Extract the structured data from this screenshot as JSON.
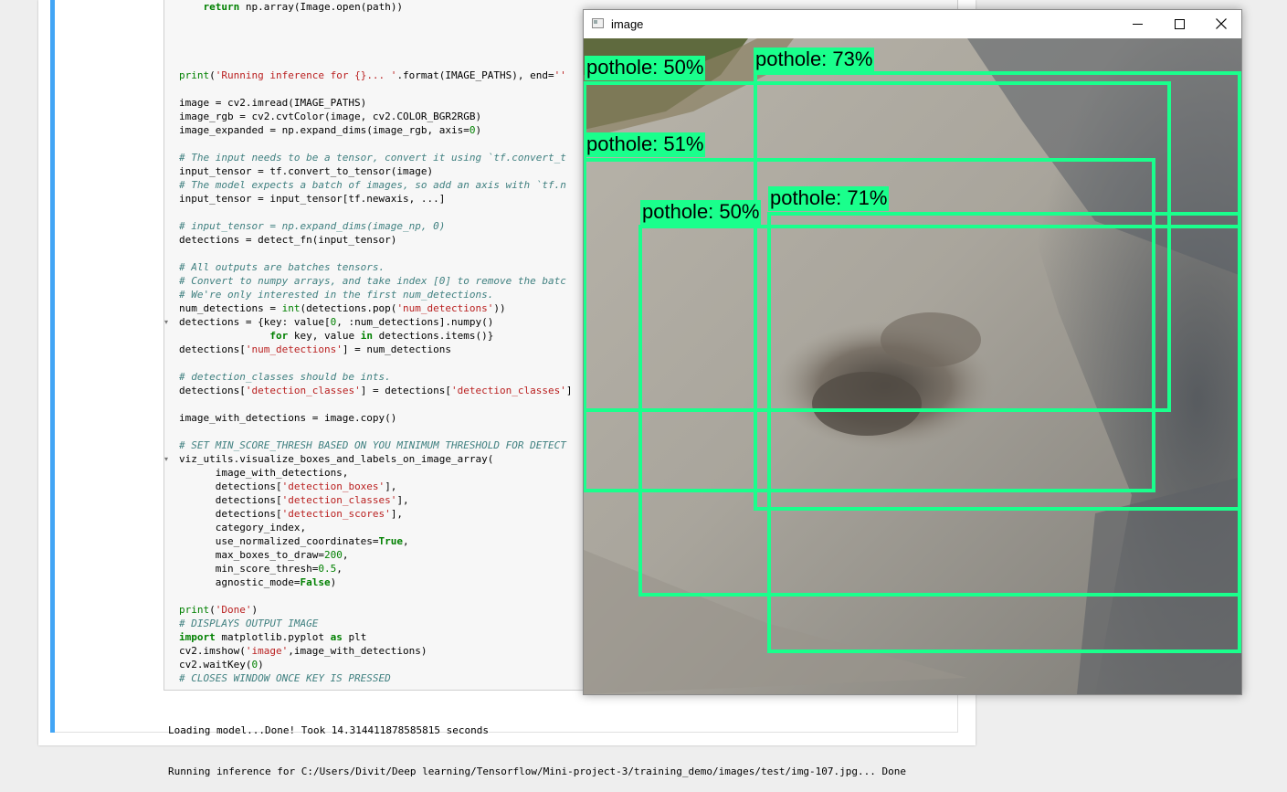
{
  "code_lines": [
    {
      "fold": false,
      "html": "    <span class=\"k\">return</span> np.array(Image.open(path))"
    },
    {
      "fold": false,
      "html": ""
    },
    {
      "fold": false,
      "html": ""
    },
    {
      "fold": false,
      "html": ""
    },
    {
      "fold": false,
      "html": ""
    },
    {
      "fold": false,
      "html": "<span class=\"n\">print</span>(<span class=\"s\">'Running inference for {}... '</span>.format(IMAGE_PATHS), end=<span class=\"s\">''</span>"
    },
    {
      "fold": false,
      "html": ""
    },
    {
      "fold": false,
      "html": "image = cv2.imread(IMAGE_PATHS)"
    },
    {
      "fold": false,
      "html": "image_rgb = cv2.cvtColor(image, cv2.COLOR_BGR2RGB)"
    },
    {
      "fold": false,
      "html": "image_expanded = np.expand_dims(image_rgb, axis=<span class=\"num\">0</span>)"
    },
    {
      "fold": false,
      "html": ""
    },
    {
      "fold": false,
      "html": "<span class=\"c\"># The input needs to be a tensor, convert it using `tf.convert_t</span>"
    },
    {
      "fold": false,
      "html": "input_tensor = tf.convert_to_tensor(image)"
    },
    {
      "fold": false,
      "html": "<span class=\"c\"># The model expects a batch of images, so add an axis with `tf.n</span>"
    },
    {
      "fold": false,
      "html": "input_tensor = input_tensor[tf.newaxis, ...]"
    },
    {
      "fold": false,
      "html": ""
    },
    {
      "fold": false,
      "html": "<span class=\"c\"># input_tensor = np.expand_dims(image_np, 0)</span>"
    },
    {
      "fold": false,
      "html": "detections = detect_fn(input_tensor)"
    },
    {
      "fold": false,
      "html": ""
    },
    {
      "fold": false,
      "html": "<span class=\"c\"># All outputs are batches tensors.</span>"
    },
    {
      "fold": false,
      "html": "<span class=\"c\"># Convert to numpy arrays, and take index [0] to remove the batc</span>"
    },
    {
      "fold": false,
      "html": "<span class=\"c\"># We're only interested in the first num_detections.</span>"
    },
    {
      "fold": false,
      "html": "num_detections = <span class=\"n\">int</span>(detections.pop(<span class=\"s\">'num_detections'</span>))"
    },
    {
      "fold": true,
      "html": "detections = {key: value[<span class=\"num\">0</span>, :num_detections].numpy()"
    },
    {
      "fold": false,
      "html": "               <span class=\"k\">for</span> key, value <span class=\"k\">in</span> detections.items()}"
    },
    {
      "fold": false,
      "html": "detections[<span class=\"s\">'num_detections'</span>] = num_detections"
    },
    {
      "fold": false,
      "html": ""
    },
    {
      "fold": false,
      "html": "<span class=\"c\"># detection_classes should be ints.</span>"
    },
    {
      "fold": false,
      "html": "detections[<span class=\"s\">'detection_classes'</span>] = detections[<span class=\"s\">'detection_classes'</span>]"
    },
    {
      "fold": false,
      "html": ""
    },
    {
      "fold": false,
      "html": "image_with_detections = image.copy()"
    },
    {
      "fold": false,
      "html": ""
    },
    {
      "fold": false,
      "html": "<span class=\"c\"># SET MIN_SCORE_THRESH BASED ON YOU MINIMUM THRESHOLD FOR DETECT</span>"
    },
    {
      "fold": true,
      "html": "viz_utils.visualize_boxes_and_labels_on_image_array("
    },
    {
      "fold": false,
      "html": "      image_with_detections,"
    },
    {
      "fold": false,
      "html": "      detections[<span class=\"s\">'detection_boxes'</span>],"
    },
    {
      "fold": false,
      "html": "      detections[<span class=\"s\">'detection_classes'</span>],"
    },
    {
      "fold": false,
      "html": "      detections[<span class=\"s\">'detection_scores'</span>],"
    },
    {
      "fold": false,
      "html": "      category_index,"
    },
    {
      "fold": false,
      "html": "      use_normalized_coordinates=<span class=\"k\">True</span>,"
    },
    {
      "fold": false,
      "html": "      max_boxes_to_draw=<span class=\"num\">200</span>,"
    },
    {
      "fold": false,
      "html": "      min_score_thresh=<span class=\"num\">0.5</span>,"
    },
    {
      "fold": false,
      "html": "      agnostic_mode=<span class=\"k\">False</span>)"
    },
    {
      "fold": false,
      "html": ""
    },
    {
      "fold": false,
      "html": "<span class=\"n\">print</span>(<span class=\"s\">'Done'</span>)"
    },
    {
      "fold": false,
      "html": "<span class=\"c\"># DISPLAYS OUTPUT IMAGE</span>"
    },
    {
      "fold": false,
      "html": "<span class=\"k\">import</span> matplotlib.pyplot <span class=\"k\">as</span> plt"
    },
    {
      "fold": false,
      "html": "cv2.imshow(<span class=\"s\">'image'</span>,image_with_detections)"
    },
    {
      "fold": false,
      "html": "cv2.waitKey(<span class=\"num\">0</span>)"
    },
    {
      "fold": false,
      "html": "<span class=\"c\"># CLOSES WINDOW ONCE KEY IS PRESSED</span>"
    }
  ],
  "output_lines": [
    "Loading model...Done! Took 14.314411878585815 seconds",
    "Running inference for C:/Users/Divit/Deep learning/Tensorflow/Mini-project-3/training_demo/images/test/img-107.jpg... Done"
  ],
  "image_window": {
    "title": "image",
    "box_color": "#1aff8c",
    "detections": [
      {
        "label": "pothole: 50%"
      },
      {
        "label": "pothole: 73%"
      },
      {
        "label": "pothole: 51%"
      },
      {
        "label": "pothole: 50%"
      },
      {
        "label": "pothole: 71%"
      }
    ]
  },
  "colors": {
    "cell_accent": "#42a5f5",
    "detection_green": "#1aff8c"
  }
}
